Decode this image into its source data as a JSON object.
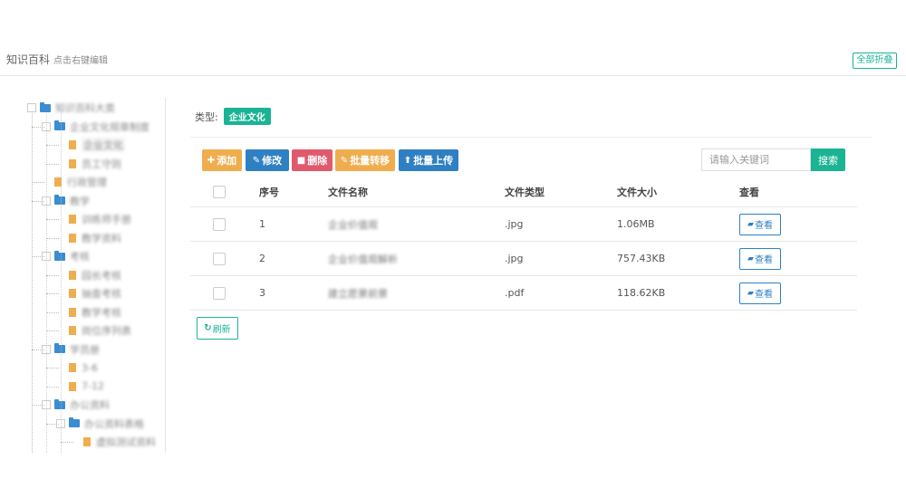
{
  "header": {
    "title": "知识百科",
    "hint": "点击右键编辑",
    "collapse_all": "全部折叠"
  },
  "tree": {
    "nodes": [
      {
        "label": "知识百科大类",
        "kind": "folder",
        "level": 0
      },
      {
        "label": "企业文化规章制度",
        "kind": "folder",
        "level": 1
      },
      {
        "label": "企业文化",
        "kind": "file",
        "level": 2,
        "selected": true
      },
      {
        "label": "员工守则",
        "kind": "file",
        "level": 2
      },
      {
        "label": "行政管理",
        "kind": "file",
        "level": 1
      },
      {
        "label": "教学",
        "kind": "folder",
        "level": 1
      },
      {
        "label": "训练师手册",
        "kind": "file",
        "level": 2
      },
      {
        "label": "教学资料",
        "kind": "file",
        "level": 2
      },
      {
        "label": "考核",
        "kind": "folder",
        "level": 1
      },
      {
        "label": "园长考核",
        "kind": "file",
        "level": 2
      },
      {
        "label": "抽查考核",
        "kind": "file",
        "level": 2
      },
      {
        "label": "教学考核",
        "kind": "file",
        "level": 2
      },
      {
        "label": "岗位序列表",
        "kind": "file",
        "level": 2
      },
      {
        "label": "学员册",
        "kind": "folder",
        "level": 1
      },
      {
        "label": "3-6",
        "kind": "file",
        "level": 2
      },
      {
        "label": "7-12",
        "kind": "file",
        "level": 2
      },
      {
        "label": "办公资料",
        "kind": "folder",
        "level": 1
      },
      {
        "label": "办公资料表格",
        "kind": "folder",
        "level": 2
      },
      {
        "label": "虚拟测试资料",
        "kind": "file",
        "level": 3
      }
    ]
  },
  "filter": {
    "type_label": "类型:",
    "type_value": "企业文化"
  },
  "toolbar": {
    "add": "添加",
    "edit": "修改",
    "delete": "删除",
    "batch_move": "批量转移",
    "batch_upload": "批量上传"
  },
  "search": {
    "placeholder": "请输入关键词",
    "button": "搜索"
  },
  "table": {
    "headers": {
      "index": "序号",
      "name": "文件名称",
      "type": "文件类型",
      "size": "文件大小",
      "view": "查看"
    },
    "rows": [
      {
        "index": "1",
        "name": "企业价值观",
        "type": ".jpg",
        "size": "1.06MB",
        "view": "查看"
      },
      {
        "index": "2",
        "name": "企业价值观解析",
        "type": ".jpg",
        "size": "757.43KB",
        "view": "查看"
      },
      {
        "index": "3",
        "name": "建立愿景前景",
        "type": ".pdf",
        "size": "118.62KB",
        "view": "查看"
      }
    ]
  },
  "refresh": "刷新",
  "colors": {
    "primary": "#2f80c2",
    "success": "#1ab394",
    "warning": "#f0ad4e",
    "danger": "#e05a6d"
  }
}
